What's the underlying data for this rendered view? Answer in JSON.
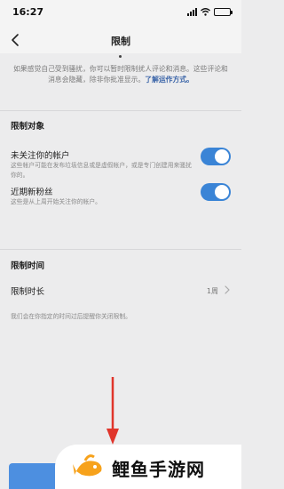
{
  "status_bar": {
    "time": "16:27"
  },
  "nav": {
    "title": "限制"
  },
  "intro": {
    "text": "如果感觉自己受到骚扰，你可以暂时限制扰人评论和消息。这些评论和消息会隐藏，除非你批准显示。",
    "link": "了解运作方式。"
  },
  "restrict_targets": {
    "heading": "限制对象",
    "non_followers": {
      "title": "未关注你的帐户",
      "description": "这些帐户可能在发布垃圾信息或是虚假帐户，或是专门创建用来骚扰你的。",
      "enabled": true
    },
    "new_followers": {
      "title": "近期新粉丝",
      "description": "这些是从上周开始关注你的帐户。",
      "enabled": true
    }
  },
  "restrict_time": {
    "heading": "限制时间",
    "duration": {
      "title": "限制时长",
      "value": "1周"
    },
    "note": "我们会在你指定的时间过后提醒你关闭限制。"
  },
  "watermark": {
    "text": "鲤鱼手游网"
  },
  "colors": {
    "accent": "#3a84d6",
    "background": "#ececed",
    "arrow": "#e0352b"
  }
}
